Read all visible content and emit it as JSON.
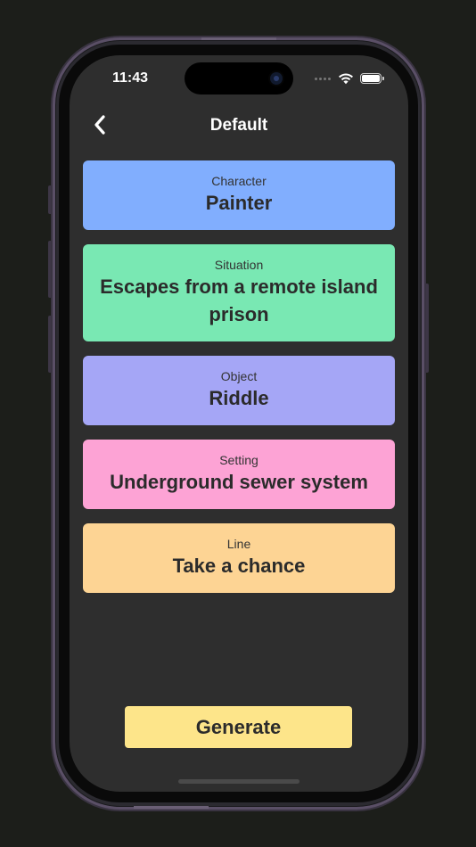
{
  "status_bar": {
    "time": "11:43"
  },
  "nav": {
    "title": "Default",
    "back_icon": "chevron-left-icon"
  },
  "cards": [
    {
      "label": "Character",
      "value": "Painter",
      "color": "#81aefe"
    },
    {
      "label": "Situation",
      "value": "Escapes from a remote island prison",
      "color": "#79e8b3"
    },
    {
      "label": "Object",
      "value": "Riddle",
      "color": "#a5a6f6"
    },
    {
      "label": "Setting",
      "value": "Underground sewer system",
      "color": "#fda3d5"
    },
    {
      "label": "Line",
      "value": "Take a chance",
      "color": "#fdd494"
    }
  ],
  "generate_button": {
    "label": "Generate",
    "color": "#fde58a"
  },
  "colors": {
    "background": "#1c1e1a",
    "screen": "#2e2e2e"
  }
}
